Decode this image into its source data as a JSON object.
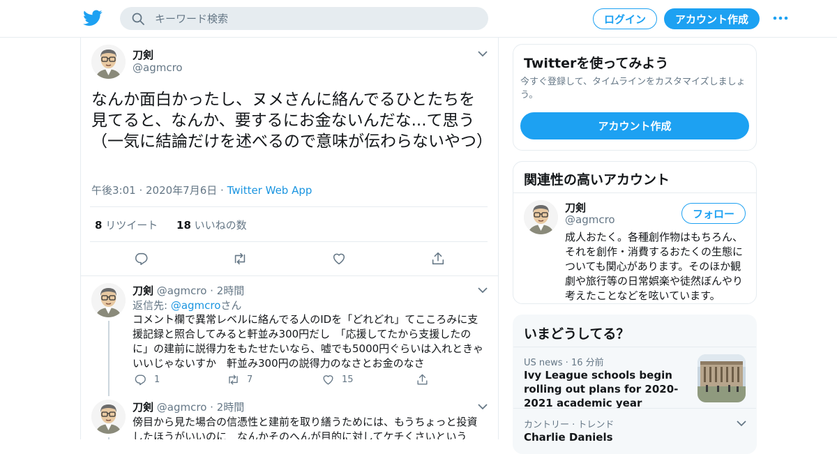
{
  "header": {
    "search_placeholder": "キーワード検索",
    "login_label": "ログイン",
    "signup_label": "アカウント作成"
  },
  "focal_tweet": {
    "name": "刀剣",
    "handle": "@agmcro",
    "text": "なんか面白かったし、ヌメさんに絡んでるひとたちを見てると、なんか、要するにお金ないんだな...て思う（一気に結論だけを述べるので意味が伝わらないやつ）",
    "time": "午後3:01",
    "date": "2020年7月6日",
    "source": "Twitter Web App",
    "retweets": "8",
    "retweets_label": "リツイート",
    "likes": "18",
    "likes_label": "いいねの数"
  },
  "replies": [
    {
      "name": "刀剣",
      "handle": "@agmcro",
      "age": "2時間",
      "reply_to_prefix": "返信先: ",
      "reply_to_handle": "@agmcro",
      "reply_to_suffix": "さん",
      "text": "コメント欄で異常レベルに絡んでる人のIDを「どれどれ」てこころみに支援記録と照合してみると軒並み300円だし　「応援してたから支援したのに」の建前に説得力をもたせたいなら、嘘でも5000円ぐらいは入れときゃいいじゃないすか　軒並み300円の説得力のなさとお金のなさ",
      "replies": "1",
      "retweets": "7",
      "likes": "15"
    },
    {
      "name": "刀剣",
      "handle": "@agmcro",
      "age": "2時間",
      "text": "傍目から見た場合の信憑性と建前を取り繕うためには、もうちょっと投資したほうがいいのに　なんかそのへんが目的に対してケチくさいという"
    }
  ],
  "signup_card": {
    "title": "Twitterを使ってみよう",
    "subtitle": "今すぐ登録して、タイムラインをカスタマイズしましょう。",
    "button": "アカウント作成"
  },
  "related_card": {
    "title": "関連性の高いアカウント",
    "name": "刀剣",
    "handle": "@agmcro",
    "follow_label": "フォロー",
    "bio": "成人おたく。各種創作物はもちろん、それを創作・消費するおたくの生態についても関心があります。そのほか観劇や旅行等の日常娯楽や徒然ぼんやり考えたことなどを呟いています。"
  },
  "trends_card": {
    "title": "いまどうしてる？",
    "items": [
      {
        "meta": "US news · 16 分前",
        "headline": "Ivy League schools begin rolling out plans for 2020-2021 academic year"
      },
      {
        "meta": "カントリー · トレンド",
        "headline": "Charlie Daniels"
      }
    ]
  },
  "colors": {
    "accent": "#1da1f2",
    "link": "#1b95e0",
    "muted": "#657786",
    "border": "#e6ecf0"
  }
}
